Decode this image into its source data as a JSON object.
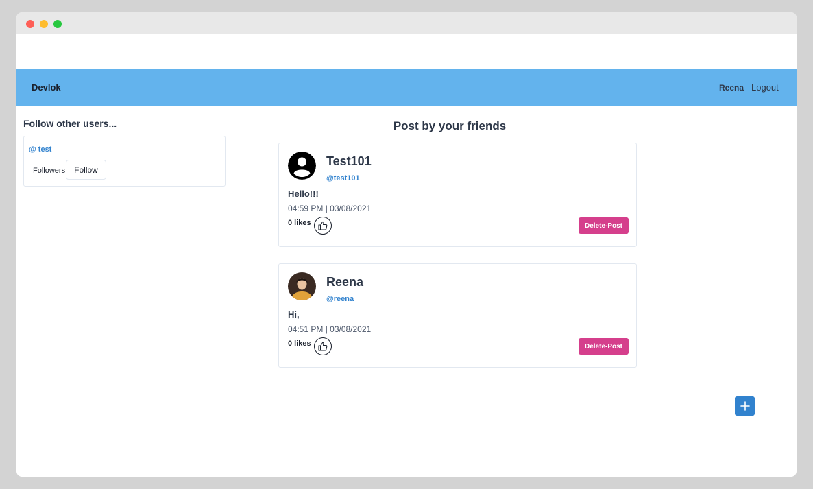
{
  "navbar": {
    "brand": "Devlok",
    "user": "Reena",
    "logout": "Logout"
  },
  "sidebar": {
    "title": "Follow other users...",
    "users": [
      {
        "handle": "@ test",
        "followers_label": "Followers",
        "follow_label": "Follow"
      }
    ]
  },
  "feed": {
    "title": "Post by your friends",
    "posts": [
      {
        "author": "Test101",
        "handle": "@test101",
        "avatar_icon": "default-user-icon",
        "content": "Hello!!!",
        "time": "04:59 PM | 03/08/2021",
        "likes": "0 likes",
        "delete_label": "Delete-Post"
      },
      {
        "author": "Reena",
        "handle": "@reena",
        "avatar_icon": "user-photo",
        "content": "Hi,",
        "time": "04:51 PM | 03/08/2021",
        "likes": "0 likes",
        "delete_label": "Delete-Post"
      }
    ]
  },
  "colors": {
    "navbar": "#63b3ed",
    "accent": "#3182ce",
    "delete": "#d53f8c"
  },
  "fab": {
    "icon": "plus-icon"
  }
}
